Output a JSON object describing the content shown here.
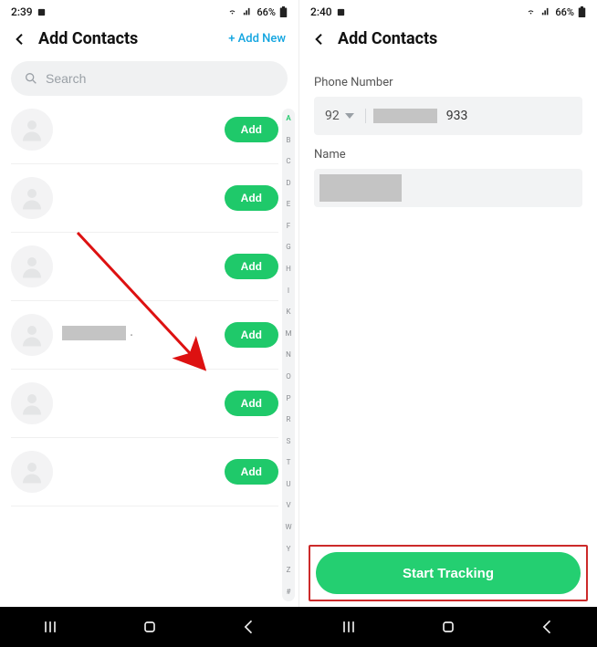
{
  "left": {
    "status": {
      "time": "2:39",
      "battery": "66%"
    },
    "header": {
      "title": "Add Contacts",
      "add_new": "+ Add New"
    },
    "search": {
      "placeholder": "Search"
    },
    "add_label": "Add",
    "contacts_count": 6,
    "index_letters": [
      "A",
      "B",
      "C",
      "D",
      "E",
      "F",
      "G",
      "H",
      "I",
      "K",
      "M",
      "N",
      "O",
      "P",
      "R",
      "S",
      "T",
      "U",
      "V",
      "W",
      "Y",
      "Z",
      "#"
    ]
  },
  "right": {
    "status": {
      "time": "2:40",
      "battery": "66%"
    },
    "header": {
      "title": "Add Contacts"
    },
    "phone_label": "Phone Number",
    "country_code": "92",
    "phone_visible_suffix": "933",
    "name_label": "Name",
    "start_tracking": "Start Tracking"
  }
}
